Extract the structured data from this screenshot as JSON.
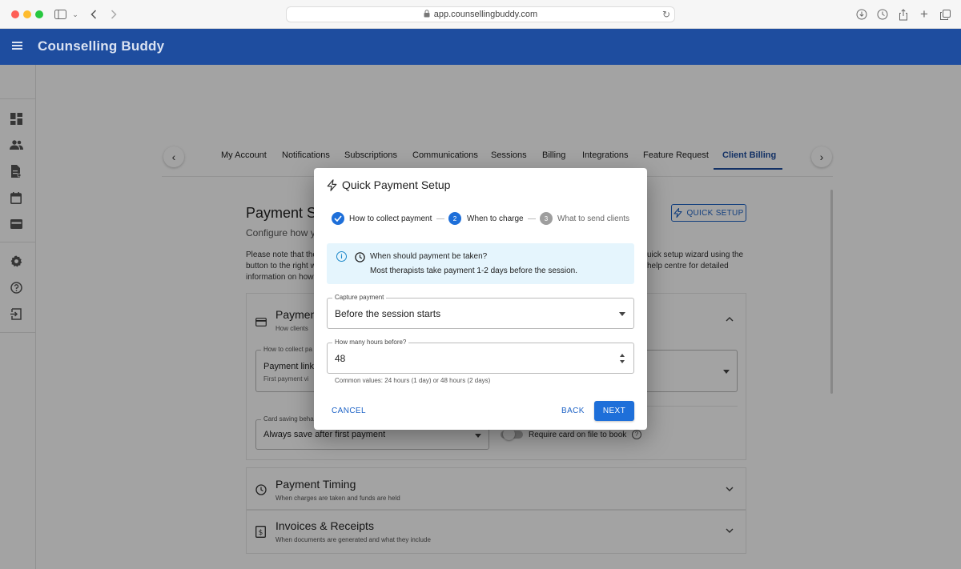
{
  "browser": {
    "url": "app.counsellingbuddy.com"
  },
  "app": {
    "title": "Counselling Buddy"
  },
  "sidenav": {
    "items": [
      {
        "icon": "dashboard-icon"
      },
      {
        "icon": "people-icon"
      },
      {
        "icon": "document-icon"
      },
      {
        "icon": "calendar-icon"
      },
      {
        "icon": "wallet-icon"
      },
      {
        "icon": "gear-icon"
      },
      {
        "icon": "help-icon"
      },
      {
        "icon": "logout-icon"
      }
    ]
  },
  "tabs": {
    "items": [
      "My Account",
      "Notifications",
      "Subscriptions",
      "Communications",
      "Sessions",
      "Billing",
      "Integrations",
      "Feature Request",
      "Client Billing"
    ],
    "active": "Client Billing"
  },
  "page": {
    "title": "Payment Se",
    "subtitle": "Configure how yo",
    "quick_setup": "QUICK SETUP",
    "note_left": "Please note that the button to the right w information on how",
    "note_right": "uick setup wizard using the help centre for detailed"
  },
  "sections": {
    "payment": {
      "title": "Paymen",
      "subtitle": "How clients",
      "collect_label": "How to collect pa",
      "collect_value": "Payment link, ",
      "collect_help": "First payment vi",
      "card_label": "Card saving beha",
      "card_value": "Always save after first payment",
      "require_card": "Require card on file to book"
    },
    "timing": {
      "title": "Payment Timing",
      "subtitle": "When charges are taken and funds are held"
    },
    "invoices": {
      "title": "Invoices & Receipts",
      "subtitle": "When documents are generated and what they include"
    }
  },
  "dialog": {
    "title": "Quick Payment Setup",
    "steps": [
      {
        "number": "",
        "label": "How to collect payment",
        "state": "done"
      },
      {
        "number": "2",
        "label": "When to charge",
        "state": "active"
      },
      {
        "number": "3",
        "label": "What to send clients",
        "state": "pending"
      }
    ],
    "info_title": "When should payment be taken?",
    "info_text": "Most therapists take payment 1-2 days before the session.",
    "capture_label": "Capture payment",
    "capture_value": "Before the session starts",
    "hours_label": "How many hours before?",
    "hours_value": "48",
    "hours_help": "Common values: 24 hours (1 day) or 48 hours (2 days)",
    "cancel": "CANCEL",
    "back": "BACK",
    "next": "NEXT"
  },
  "colors": {
    "appbar": "#1e4d9f",
    "primary": "#1e6fd9",
    "info_bg": "#e5f5fd",
    "step_pending": "#9e9e9e"
  }
}
